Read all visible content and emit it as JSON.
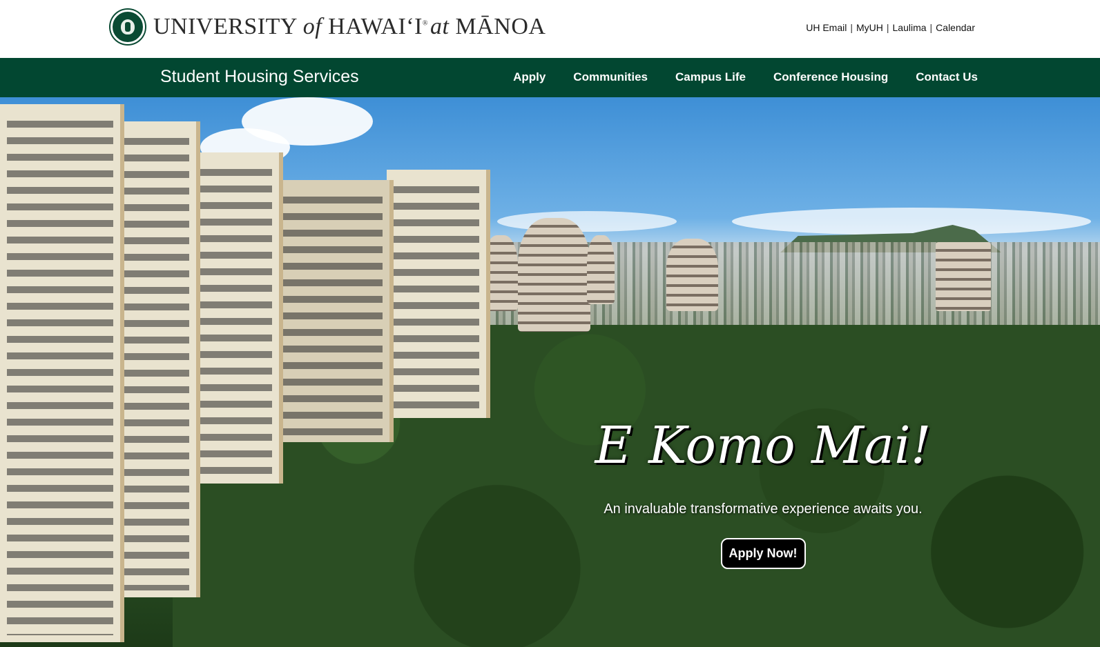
{
  "header": {
    "logo_text": {
      "part1": "UNIVERSITY ",
      "part2": "of",
      "part3": " HAWAIʻI",
      "part4": "® ",
      "part5": "at",
      "part6": " MĀNOA"
    },
    "utility_links": [
      "UH Email",
      "MyUH",
      "Laulima",
      "Calendar"
    ],
    "separator": "|"
  },
  "navbar": {
    "site_title": "Student Housing Services",
    "items": [
      "Apply",
      "Communities",
      "Campus Life",
      "Conference Housing",
      "Contact Us"
    ]
  },
  "hero": {
    "greeting": "E Komo Mai!",
    "tagline": "An invaluable transformative experience awaits you.",
    "cta_label": "Apply Now!"
  },
  "colors": {
    "brand_green": "#024731",
    "header_bg": "#ffffff",
    "text_dark": "#111111"
  },
  "icons": {
    "seal": "university-seal-icon"
  }
}
